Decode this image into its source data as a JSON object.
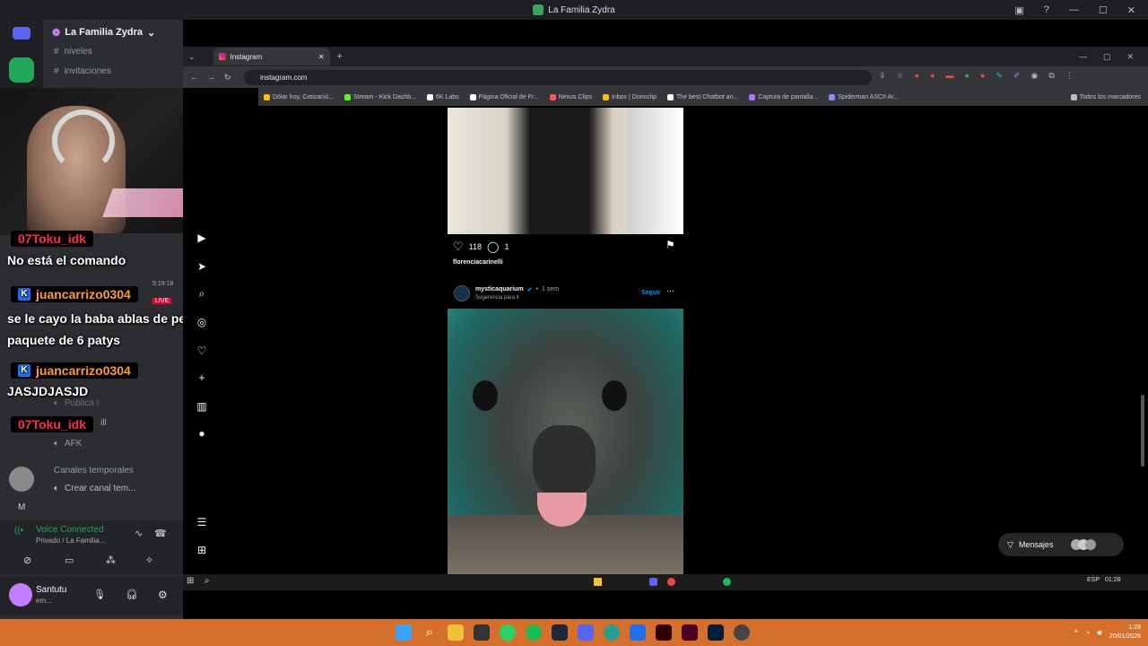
{
  "window": {
    "title": "La Familia Zydra"
  },
  "discord": {
    "server_name": "La Familia Zydra",
    "channels": [
      "niveles",
      "invitaciones"
    ],
    "temp_header": "Canales temporales",
    "create_channel": "Crear canal tem...",
    "public_channel": "Publica I",
    "afk_channel": "AFK",
    "voice_status": "Voice Connected",
    "voice_path": "Privado / La Familia...",
    "user_name": "Santutu",
    "user_status": "em...",
    "user_initial": "M"
  },
  "chat": [
    {
      "user": "07Toku_idk",
      "message": "No está el comando",
      "color": "#ff2d4b",
      "platform": ""
    },
    {
      "user": "juancarrizo0304",
      "message": "se le cayo la baba ablas de pensar en un paquete de 6 patys",
      "color": "#ff9d2e",
      "platform": "kick"
    },
    {
      "user": "juancarrizo0304",
      "message": "JASJDJASJD",
      "color": "#ff9d2e",
      "platform": "kick"
    },
    {
      "user": "07Toku_idk",
      "message": "",
      "color": "#ff2d4b",
      "platform": ""
    }
  ],
  "chat_extra": {
    "live": "LIVE",
    "time": "5:19:18",
    "ill": "ill"
  },
  "browser": {
    "tab_title": "Instagram",
    "url": "instagram.com",
    "bookmarks": [
      "Dólar hoy, Cotizació...",
      "Stream - Kick Dashb...",
      "6K Labs",
      "Página Oficial de Fr...",
      "Nexus Clips",
      "Inbox | Donoclip",
      "The best Chatbot an...",
      "Captura de pantalla...",
      "Spiderman ASCII Ar..."
    ],
    "all_bookmarks": "Todos los marcadores"
  },
  "instagram": {
    "post1": {
      "likes": "118",
      "comments": "1",
      "username": "florenciacarinelli"
    },
    "post2": {
      "username": "mysticaquarium",
      "time": "1 sem",
      "subtitle": "Sugerencia para ti",
      "follow": "Seguir"
    },
    "messages": "Mensajes"
  },
  "inner_taskbar": {
    "lang": "ESP",
    "time": "01:28"
  },
  "taskbar": {
    "time": "1:28",
    "date": "20/01/2026"
  }
}
